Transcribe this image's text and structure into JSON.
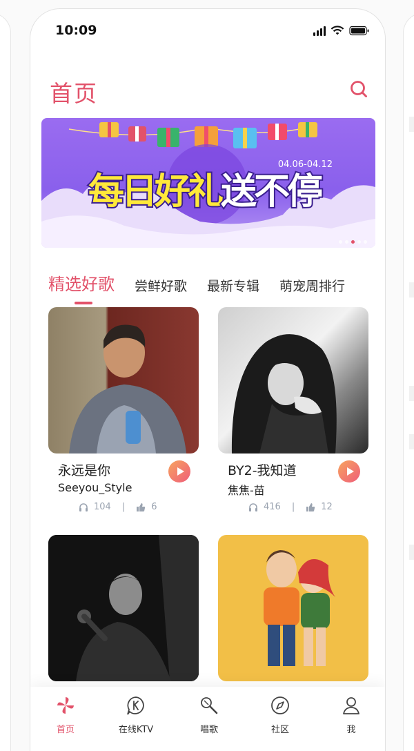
{
  "status_bar": {
    "time": "10:09"
  },
  "header": {
    "title": "首页"
  },
  "banner": {
    "title_part1": "每日好礼",
    "title_part2": "送不停",
    "date_range": "04.06-04.12",
    "dots_count": 5,
    "active_dot": 2
  },
  "tabs": [
    {
      "label": "精选好歌",
      "active": true
    },
    {
      "label": "尝鲜好歌",
      "active": false
    },
    {
      "label": "最新专辑",
      "active": false
    },
    {
      "label": "萌宠周排行",
      "active": false
    }
  ],
  "songs": [
    {
      "title": "永远是你",
      "artist": "Seeyou_Style",
      "listens": "104",
      "likes": "6"
    },
    {
      "title": "BY2-我知道",
      "artist": "焦焦-苗",
      "listens": "416",
      "likes": "12"
    },
    {
      "title": "",
      "artist": "",
      "listens": "",
      "likes": ""
    },
    {
      "title": "",
      "artist": "",
      "listens": "",
      "likes": ""
    }
  ],
  "tabbar": [
    {
      "label": "首页",
      "icon": "pinwheel-icon",
      "active": true
    },
    {
      "label": "在线KTV",
      "icon": "ktv-icon",
      "active": false
    },
    {
      "label": "唱歌",
      "icon": "microphone-icon",
      "active": false
    },
    {
      "label": "社区",
      "icon": "compass-icon",
      "active": false
    },
    {
      "label": "我",
      "icon": "person-icon",
      "active": false
    }
  ],
  "colors": {
    "accent": "#e2526a",
    "banner_purple": "#8a60ec",
    "muted": "#9aa3b0"
  }
}
